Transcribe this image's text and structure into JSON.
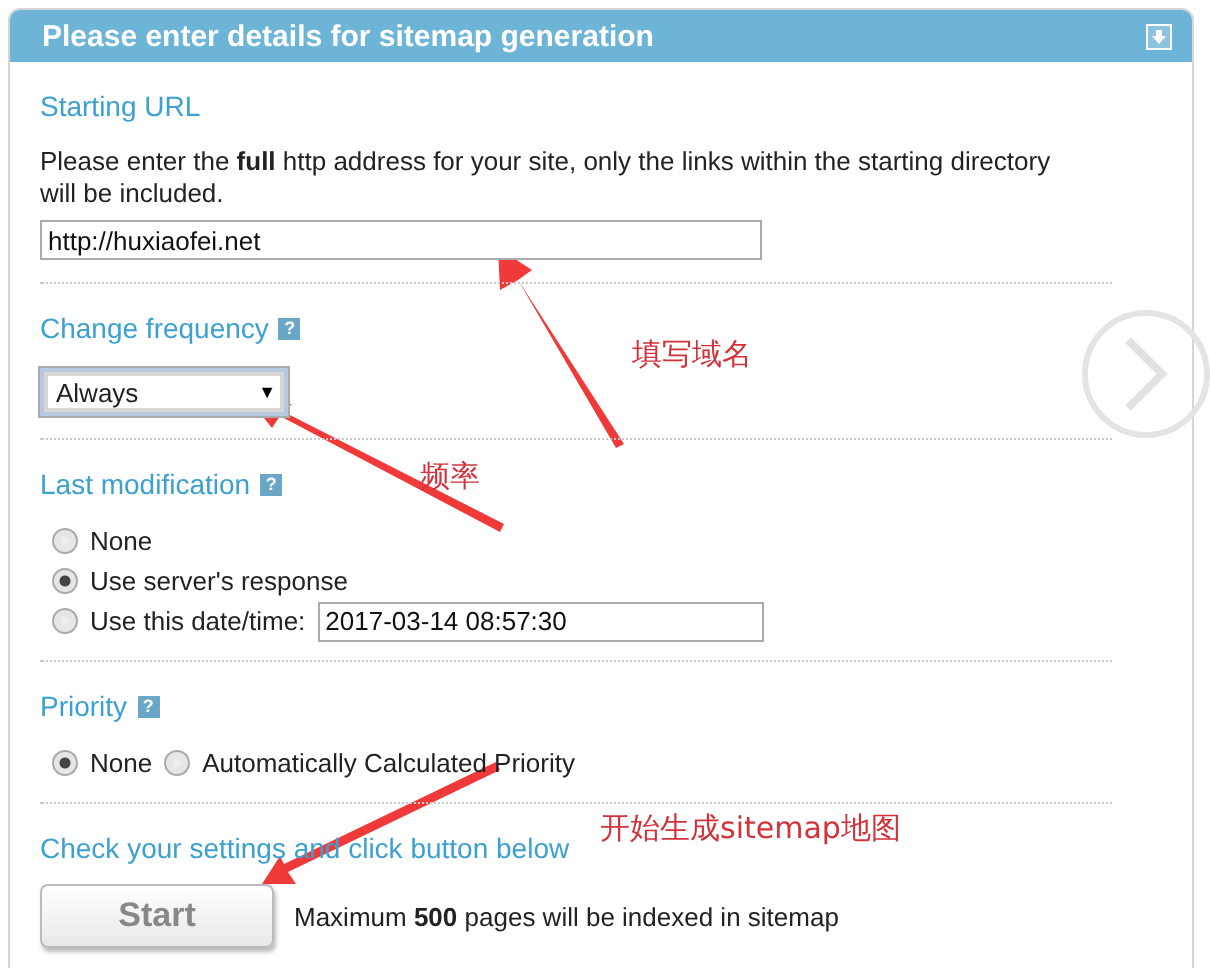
{
  "panel": {
    "title": "Please enter details for sitemap generation"
  },
  "sections": [
    {
      "kind": "url",
      "heading": "Starting URL",
      "description": "Please enter the **full** http address for your site, only the links within the starting directory will be included.",
      "value": "http://huxiaofei.net"
    },
    {
      "kind": "select",
      "heading": "Change frequency",
      "help": "?",
      "value": "Always",
      "caret": "▼"
    },
    {
      "kind": "radios",
      "heading": "Last modification",
      "help": "?",
      "options": [
        {
          "label": "None",
          "selected": false
        },
        {
          "label": "Use server's response",
          "selected": true
        },
        {
          "label": "Use this date/time:",
          "selected": false,
          "value": "2017-03-14 08:57:30"
        }
      ]
    },
    {
      "kind": "inline-radios",
      "heading": "Priority",
      "help": "?",
      "options": [
        {
          "label": "None",
          "selected": true
        },
        {
          "label": "Automatically Calculated Priority",
          "selected": false
        }
      ]
    },
    {
      "kind": "start",
      "heading": "Check your settings and click button below",
      "button": "Start",
      "note": "Maximum **500** pages will be indexed in sitemap"
    }
  ],
  "annotations": [
    {
      "text": "填写域名"
    },
    {
      "text": "频率"
    },
    {
      "text": "开始生成sitemap地图"
    }
  ]
}
